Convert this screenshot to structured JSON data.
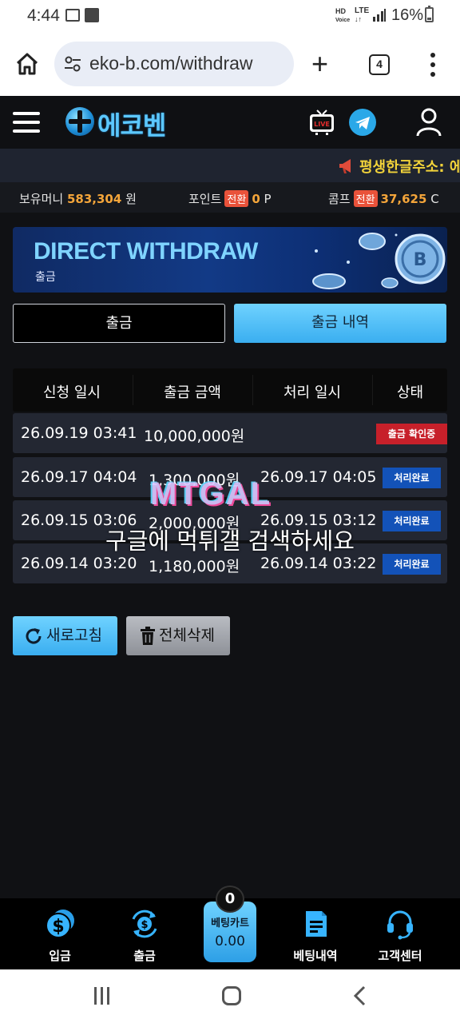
{
  "status_bar": {
    "time": "4:44",
    "network_hd": "HD",
    "network_voice": "Voice",
    "network_lte": "LTE",
    "battery": "16%"
  },
  "browser": {
    "url": "eko-b.com/withdraw",
    "tab_count": "4"
  },
  "header": {
    "logo_text": "에코벤",
    "live_badge": "LIVE"
  },
  "marquee": {
    "text": "평생한글주소: 에"
  },
  "balance": {
    "money_label": "보유머니",
    "money_value": "583,304",
    "money_unit": "원",
    "point_label": "포인트",
    "point_swap": "전환",
    "point_value": "0",
    "point_unit": "P",
    "comp_label": "콤프",
    "comp_swap": "전환",
    "comp_value": "37,625",
    "comp_unit": "C"
  },
  "banner": {
    "title": "DIRECT WITHDRAW",
    "subtitle": "출금"
  },
  "tabs": {
    "withdraw": "출금",
    "history": "출금 내역"
  },
  "table": {
    "headers": [
      "신청 일시",
      "출금 금액",
      "처리 일시",
      "상태"
    ],
    "rows": [
      {
        "requested": "26.09.19 03:41",
        "amount": "10,000,000원",
        "processed": "",
        "status": "출금 확인중"
      },
      {
        "requested": "26.09.17 04:04",
        "amount": "1,300,000원",
        "processed": "26.09.17 04:05",
        "status": "처리완료"
      },
      {
        "requested": "26.09.15 03:06",
        "amount": "2,000,000원",
        "processed": "26.09.15 03:12",
        "status": "처리완료"
      },
      {
        "requested": "26.09.14 03:20",
        "amount": "1,180,000원",
        "processed": "26.09.14 03:22",
        "status": "처리완료"
      }
    ]
  },
  "watermark": {
    "logo": "MTGAL",
    "caption": "구글에 먹튀갤 검색하세요"
  },
  "actions": {
    "refresh": "새로고침",
    "delete_all": "전체삭제"
  },
  "bottom_nav": {
    "deposit": "입금",
    "withdraw": "출금",
    "bet_cart_label": "베팅카트",
    "bet_cart_amount": "0.00",
    "bet_cart_count": "0",
    "bet_history": "베팅내역",
    "support": "고객센터"
  },
  "colors": {
    "accent": "#3aaef0",
    "balance_value": "#f4a53a",
    "pending": "#c7202a",
    "done": "#1352b8",
    "marquee_text": "#f2d33a"
  }
}
